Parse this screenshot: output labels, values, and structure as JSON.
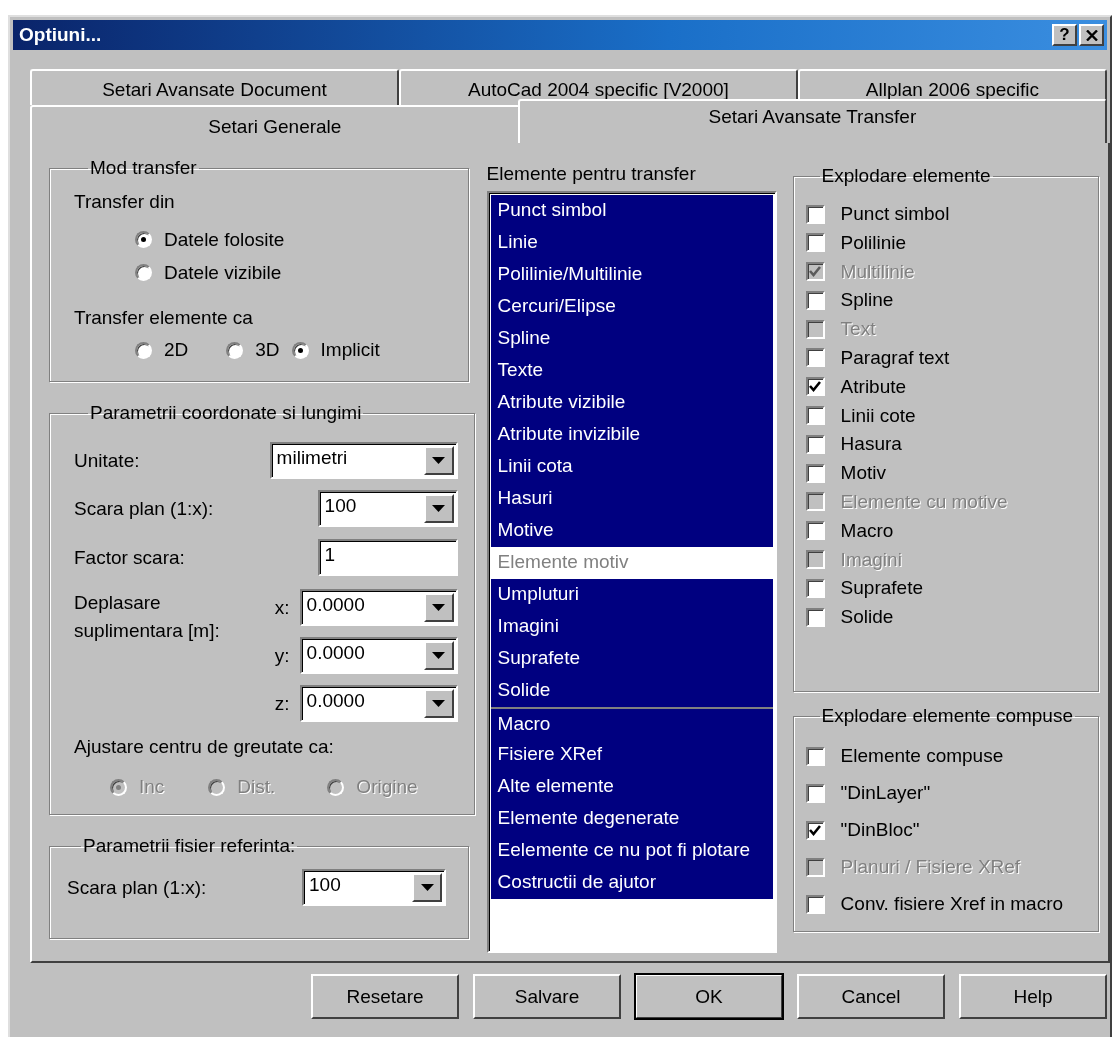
{
  "window": {
    "title": "Optiuni...",
    "help_button": "?"
  },
  "tab_rows": [
    {
      "tabs": [
        {
          "label": "Setari Avansate Document",
          "selected": false
        },
        {
          "label": "AutoCad 2004 specific [V2000]",
          "selected": false
        },
        {
          "label": "Allplan 2006 specific",
          "selected": false
        }
      ]
    },
    {
      "tabs": [
        {
          "label": "Setari Generale",
          "selected": false
        },
        {
          "label": "Setari Avansate Transfer",
          "selected": true
        }
      ]
    }
  ],
  "mod_transfer": {
    "title": "Mod transfer",
    "transfer_din": {
      "label": "Transfer din",
      "options": [
        {
          "label": "Datele folosite",
          "selected": true
        },
        {
          "label": "Datele vizibile",
          "selected": false
        }
      ]
    },
    "transfer_ca": {
      "label": "Transfer elemente ca",
      "options": [
        {
          "label": "2D",
          "selected": false
        },
        {
          "label": "3D",
          "selected": false
        },
        {
          "label": "Implicit",
          "selected": true
        }
      ]
    }
  },
  "coordonate": {
    "title": "Parametrii coordonate si lungimi",
    "unitate": {
      "label": "Unitate:",
      "value": "milimetri"
    },
    "scara": {
      "label": "Scara plan (1:x):",
      "value": "100"
    },
    "factor": {
      "label": "Factor scara:",
      "value": "1"
    },
    "deplasare": {
      "label": "Deplasare suplimentara [m]:",
      "axes": [
        {
          "label": "x:",
          "value": "0.0000"
        },
        {
          "label": "y:",
          "value": "0.0000"
        },
        {
          "label": "z:",
          "value": "0.0000"
        }
      ]
    },
    "ajustare": {
      "label": "Ajustare centru de greutate ca:",
      "options": [
        {
          "label": "Inc",
          "selected": true,
          "disabled": true
        },
        {
          "label": "Dist.",
          "selected": false,
          "disabled": true
        },
        {
          "label": "Origine",
          "selected": false,
          "disabled": true
        }
      ]
    }
  },
  "referinta": {
    "title": "Parametrii fisier referinta:",
    "scara": {
      "label": "Scara plan (1:x):",
      "value": "100"
    }
  },
  "elemente": {
    "label": "Elemente pentru transfer",
    "items": [
      {
        "label": "Punct simbol",
        "selected": true,
        "disabled": false,
        "separator": false
      },
      {
        "label": "Linie",
        "selected": true,
        "disabled": false,
        "separator": false
      },
      {
        "label": "Polilinie/Multilinie",
        "selected": true,
        "disabled": false,
        "separator": false
      },
      {
        "label": "Cercuri/Elipse",
        "selected": true,
        "disabled": false,
        "separator": false
      },
      {
        "label": "Spline",
        "selected": true,
        "disabled": false,
        "separator": false
      },
      {
        "label": "Texte",
        "selected": true,
        "disabled": false,
        "separator": false
      },
      {
        "label": "Atribute vizibile",
        "selected": true,
        "disabled": false,
        "separator": false
      },
      {
        "label": "Atribute invizibile",
        "selected": true,
        "disabled": false,
        "separator": false
      },
      {
        "label": "Linii cota",
        "selected": true,
        "disabled": false,
        "separator": false
      },
      {
        "label": "Hasuri",
        "selected": true,
        "disabled": false,
        "separator": false
      },
      {
        "label": "Motive",
        "selected": true,
        "disabled": false,
        "separator": false
      },
      {
        "label": "Elemente motiv",
        "selected": false,
        "disabled": true,
        "separator": false
      },
      {
        "label": "Umpluturi",
        "selected": true,
        "disabled": false,
        "separator": false
      },
      {
        "label": "Imagini",
        "selected": true,
        "disabled": false,
        "separator": false
      },
      {
        "label": "Suprafete",
        "selected": true,
        "disabled": false,
        "separator": false
      },
      {
        "label": "Solide",
        "selected": true,
        "disabled": false,
        "separator": false
      },
      {
        "label": "Macro",
        "selected": true,
        "disabled": false,
        "separator": true
      },
      {
        "label": "Fisiere XRef",
        "selected": true,
        "disabled": false,
        "separator": false
      },
      {
        "label": "Alte elemente",
        "selected": true,
        "disabled": false,
        "separator": false
      },
      {
        "label": "Elemente degenerate",
        "selected": true,
        "disabled": false,
        "separator": false
      },
      {
        "label": "Eelemente ce nu pot fi plotare",
        "selected": true,
        "disabled": false,
        "separator": false
      },
      {
        "label": "Costructii de ajutor",
        "selected": true,
        "disabled": false,
        "separator": false
      }
    ]
  },
  "explodare": {
    "title": "Explodare elemente",
    "items": [
      {
        "label": "Punct simbol",
        "checked": false,
        "disabled": false
      },
      {
        "label": "Polilinie",
        "checked": false,
        "disabled": false
      },
      {
        "label": "Multilinie",
        "checked": true,
        "disabled": true
      },
      {
        "label": "Spline",
        "checked": false,
        "disabled": false
      },
      {
        "label": "Text",
        "checked": false,
        "disabled": true
      },
      {
        "label": "Paragraf text",
        "checked": false,
        "disabled": false
      },
      {
        "label": "Atribute",
        "checked": true,
        "disabled": false
      },
      {
        "label": "Linii cote",
        "checked": false,
        "disabled": false
      },
      {
        "label": "Hasura",
        "checked": false,
        "disabled": false
      },
      {
        "label": "Motiv",
        "checked": false,
        "disabled": false
      },
      {
        "label": "Elemente cu motive",
        "checked": false,
        "disabled": true
      },
      {
        "label": "Macro",
        "checked": false,
        "disabled": false
      },
      {
        "label": "Imagini",
        "checked": false,
        "disabled": true
      },
      {
        "label": "Suprafete",
        "checked": false,
        "disabled": false
      },
      {
        "label": "Solide",
        "checked": false,
        "disabled": false
      }
    ]
  },
  "explodare_compuse": {
    "title": "Explodare elemente compuse",
    "items": [
      {
        "label": "Elemente compuse",
        "checked": false,
        "disabled": false
      },
      {
        "label": "\"DinLayer\"",
        "checked": false,
        "disabled": false
      },
      {
        "label": "\"DinBloc\"",
        "checked": true,
        "disabled": false
      },
      {
        "label": "Planuri / Fisiere XRef",
        "checked": false,
        "disabled": true
      },
      {
        "label": "Conv. fisiere Xref in macro",
        "checked": false,
        "disabled": false
      }
    ]
  },
  "buttons": [
    {
      "label": "Resetare",
      "default": false
    },
    {
      "label": "Salvare",
      "default": false
    },
    {
      "label": "OK",
      "default": true
    },
    {
      "label": "Cancel",
      "default": false
    },
    {
      "label": "Help",
      "default": false
    }
  ]
}
